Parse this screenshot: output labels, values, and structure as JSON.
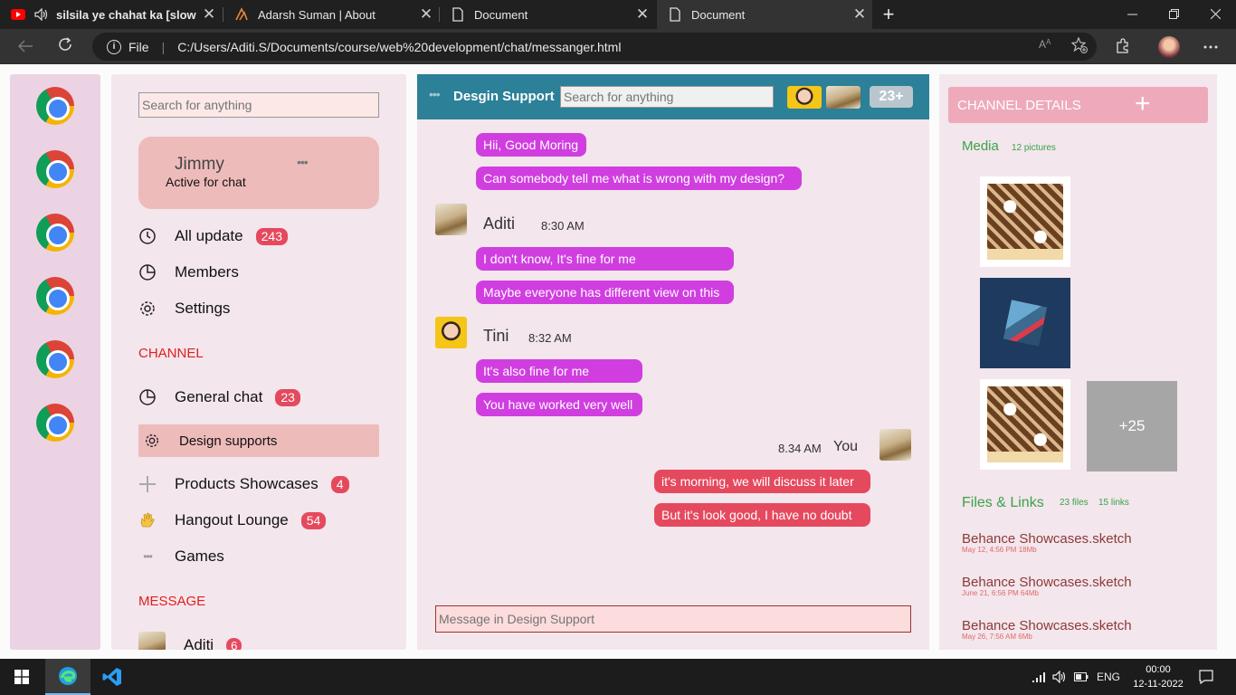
{
  "browser": {
    "tabs": [
      {
        "title": "silsila ye chahat ka [slowe",
        "icon": "youtube-icon",
        "close": "✕",
        "sound": "speaker-icon"
      },
      {
        "title": "Adarsh Suman | About",
        "icon": "site-logo-icon",
        "close": "✕"
      },
      {
        "title": "Document",
        "icon": "document-icon",
        "close": "✕"
      },
      {
        "title": "Document",
        "icon": "document-icon",
        "close": "✕",
        "active": true
      }
    ],
    "new_tab": "+",
    "address": {
      "info_symbol": "i",
      "scheme_label": "File",
      "url": "C:/Users/Aditi.S/Documents/course/web%20development/chat/messanger.html"
    }
  },
  "rail": {
    "apps": [
      "chrome-icon",
      "chrome-icon",
      "chrome-icon",
      "chrome-icon",
      "chrome-icon",
      "chrome-icon"
    ]
  },
  "sidebar": {
    "search_placeholder": "Search for anything",
    "profile": {
      "name": "Jimmy",
      "status": "Active for chat",
      "more": "•••"
    },
    "nav": [
      {
        "label": "All update",
        "badge": "243",
        "icon": "refresh-icon"
      },
      {
        "label": "Members",
        "icon": "pie-chart-icon"
      },
      {
        "label": "Settings",
        "icon": "gear-icon"
      }
    ],
    "channel_heading": "CHANNEL",
    "channels": [
      {
        "label": "General chat",
        "badge": "23",
        "icon": "pie-chart-icon"
      },
      {
        "label": "Design supports",
        "icon": "gear-icon",
        "active": true
      },
      {
        "label": "Products Showcases",
        "badge": "4",
        "icon": "plus-icon"
      },
      {
        "label": "Hangout Lounge",
        "badge": "54",
        "icon": "waving-hand-icon"
      },
      {
        "label": "Games",
        "icon": "dots-icon",
        "dots": "•••"
      }
    ],
    "message_heading": "MESSAGE",
    "messages": [
      {
        "label": "Aditi",
        "badge": "6"
      }
    ]
  },
  "chat": {
    "dots": "•••",
    "title": "Desgin Support",
    "search_placeholder": "Search for anything",
    "more_count": "23+",
    "messages": [
      {
        "text": "Hii, Good Moring"
      },
      {
        "text": "Can somebody tell me what is wrong with my design?"
      },
      {
        "sender": "Aditi",
        "time": "8:30 AM"
      },
      {
        "text": "I don't know, It's fine for me"
      },
      {
        "text": "Maybe everyone has different view on this"
      },
      {
        "sender": "Tini",
        "time": "8:32 AM"
      },
      {
        "text": "It's also fine for me"
      },
      {
        "text": "You have worked very well"
      },
      {
        "sender": "You",
        "time": "8.34 AM"
      },
      {
        "text": "it's morning, we will discuss it later"
      },
      {
        "text": "But it's look good, I have no doubt"
      }
    ],
    "composer_placeholder": "Message in Design Support"
  },
  "details": {
    "title": "CHANNEL DETAILS",
    "add": "+",
    "media_heading": "Media",
    "media_count": "12 pictures",
    "more_media": "+25",
    "files_heading": "Files & Links",
    "files_count": "23 files",
    "links_count": "15 links",
    "files": [
      {
        "name": "Behance Showcases.sketch",
        "meta": "May 12, 4:56 PM 18Mb"
      },
      {
        "name": "Behance Showcases.sketch",
        "meta": "June 21, 6:56 PM 64Mb"
      },
      {
        "name": "Behance Showcases.sketch",
        "meta": "May 26, 7:56 AM 6Mb"
      }
    ]
  },
  "taskbar": {
    "lang": "ENG",
    "time": "00:00",
    "date": "12-11-2022"
  },
  "colors": {
    "accent": "#2c8098",
    "incoming": "#d03ee0",
    "outgoing": "#e5495e",
    "badge": "#e5495e"
  }
}
